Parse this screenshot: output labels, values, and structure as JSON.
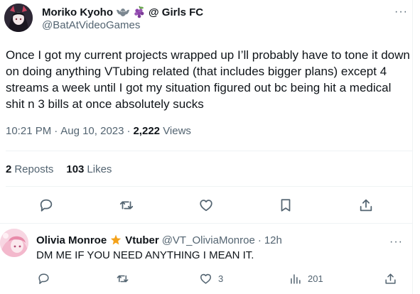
{
  "tweet": {
    "author_name": "Moriko Kyoho",
    "name_suffix": "@ Girls FC",
    "handle": "@BatAtVideoGames",
    "text": "Once I got my current projects wrapped up I’ll probably have to tone it down on doing anything VTubing related (that includes bigger plans) except 4 streams a week until I got my situation figured out bc being hit a medical shit n 3 bills at once absolutely sucks",
    "time": "10:21 PM",
    "date": "Aug 10, 2023",
    "views_count": "2,222",
    "views_label": "Views",
    "reposts_count": "2",
    "reposts_label": "Reposts",
    "likes_count": "103",
    "likes_label": "Likes",
    "more_label": "···",
    "actions": [
      "reply-icon",
      "repost-icon",
      "like-icon",
      "bookmark-icon",
      "share-icon"
    ]
  },
  "reply": {
    "author_name": "Olivia Monroe",
    "badge_label": "Vtuber",
    "handle": "@VT_OliviaMonroe",
    "separator": "·",
    "age": "12h",
    "text": "DM ME IF YOU NEED ANYTHING I MEAN IT.",
    "likes_count": "3",
    "views_count": "201",
    "more_label": "···"
  },
  "colors": {
    "text": "#0f1419",
    "secondary": "#536471",
    "divider": "#eff3f4",
    "badge_star": "#f4a21a"
  }
}
